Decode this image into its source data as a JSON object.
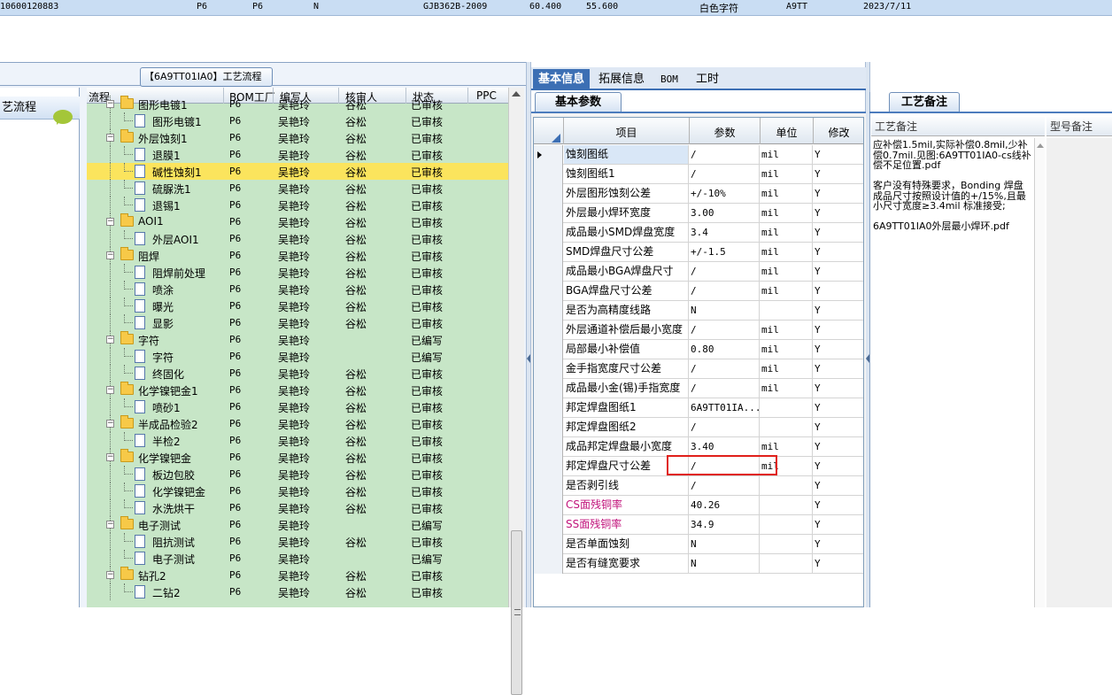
{
  "top_row": {
    "id": "10600120883",
    "c1": "P6",
    "c2": "P6",
    "c3": "N",
    "std": "GJB362B-2009",
    "v1": "60.400",
    "v2": "55.600",
    "char": "白色字符",
    "code": "A9TT",
    "date": "2023/7/11"
  },
  "left": {
    "process_button": "【6A9TT01IA0】工艺流程",
    "side_item": "艺流程",
    "tree_headers": [
      "流程",
      "BOM工厂",
      "编写人",
      "核审人",
      "状态",
      "PPC"
    ],
    "rows": [
      {
        "name": "图形电镀1",
        "type": "folder",
        "level": 1,
        "bom": "P6",
        "writer": "吴艳玲",
        "reviewer": "谷松",
        "status": "已审核"
      },
      {
        "name": "图形电镀1",
        "type": "doc",
        "level": 2,
        "bom": "P6",
        "writer": "吴艳玲",
        "reviewer": "谷松",
        "status": "已审核"
      },
      {
        "name": "外层蚀刻1",
        "type": "folder",
        "level": 1,
        "bom": "P6",
        "writer": "吴艳玲",
        "reviewer": "谷松",
        "status": "已审核"
      },
      {
        "name": "退膜1",
        "type": "doc",
        "level": 2,
        "bom": "P6",
        "writer": "吴艳玲",
        "reviewer": "谷松",
        "status": "已审核"
      },
      {
        "name": "碱性蚀刻1",
        "type": "doc",
        "level": 2,
        "bom": "P6",
        "writer": "吴艳玲",
        "reviewer": "谷松",
        "status": "已审核",
        "selected": true
      },
      {
        "name": "硫脲洗1",
        "type": "doc",
        "level": 2,
        "bom": "P6",
        "writer": "吴艳玲",
        "reviewer": "谷松",
        "status": "已审核"
      },
      {
        "name": "退锡1",
        "type": "doc",
        "level": 2,
        "bom": "P6",
        "writer": "吴艳玲",
        "reviewer": "谷松",
        "status": "已审核"
      },
      {
        "name": "AOI1",
        "type": "folder",
        "level": 1,
        "bom": "P6",
        "writer": "吴艳玲",
        "reviewer": "谷松",
        "status": "已审核"
      },
      {
        "name": "外层AOI1",
        "type": "doc",
        "level": 2,
        "bom": "P6",
        "writer": "吴艳玲",
        "reviewer": "谷松",
        "status": "已审核"
      },
      {
        "name": "阻焊",
        "type": "folder",
        "level": 1,
        "bom": "P6",
        "writer": "吴艳玲",
        "reviewer": "谷松",
        "status": "已审核"
      },
      {
        "name": "阻焊前处理",
        "type": "doc",
        "level": 2,
        "bom": "P6",
        "writer": "吴艳玲",
        "reviewer": "谷松",
        "status": "已审核"
      },
      {
        "name": "喷涂",
        "type": "doc",
        "level": 2,
        "bom": "P6",
        "writer": "吴艳玲",
        "reviewer": "谷松",
        "status": "已审核"
      },
      {
        "name": "曝光",
        "type": "doc",
        "level": 2,
        "bom": "P6",
        "writer": "吴艳玲",
        "reviewer": "谷松",
        "status": "已审核"
      },
      {
        "name": "显影",
        "type": "doc",
        "level": 2,
        "bom": "P6",
        "writer": "吴艳玲",
        "reviewer": "谷松",
        "status": "已审核"
      },
      {
        "name": "字符",
        "type": "folder",
        "level": 1,
        "bom": "P6",
        "writer": "吴艳玲",
        "reviewer": "",
        "status": "已编写"
      },
      {
        "name": "字符",
        "type": "doc",
        "level": 2,
        "bom": "P6",
        "writer": "吴艳玲",
        "reviewer": "",
        "status": "已编写"
      },
      {
        "name": "终固化",
        "type": "doc",
        "level": 2,
        "bom": "P6",
        "writer": "吴艳玲",
        "reviewer": "谷松",
        "status": "已审核"
      },
      {
        "name": "化学镍钯金1",
        "type": "folder",
        "level": 1,
        "bom": "P6",
        "writer": "吴艳玲",
        "reviewer": "谷松",
        "status": "已审核"
      },
      {
        "name": "喷砂1",
        "type": "doc",
        "level": 2,
        "bom": "P6",
        "writer": "吴艳玲",
        "reviewer": "谷松",
        "status": "已审核"
      },
      {
        "name": "半成品检验2",
        "type": "folder",
        "level": 1,
        "bom": "P6",
        "writer": "吴艳玲",
        "reviewer": "谷松",
        "status": "已审核"
      },
      {
        "name": "半检2",
        "type": "doc",
        "level": 2,
        "bom": "P6",
        "writer": "吴艳玲",
        "reviewer": "谷松",
        "status": "已审核"
      },
      {
        "name": "化学镍钯金",
        "type": "folder",
        "level": 1,
        "bom": "P6",
        "writer": "吴艳玲",
        "reviewer": "谷松",
        "status": "已审核"
      },
      {
        "name": "板边包胶",
        "type": "doc",
        "level": 2,
        "bom": "P6",
        "writer": "吴艳玲",
        "reviewer": "谷松",
        "status": "已审核"
      },
      {
        "name": "化学镍钯金",
        "type": "doc",
        "level": 2,
        "bom": "P6",
        "writer": "吴艳玲",
        "reviewer": "谷松",
        "status": "已审核"
      },
      {
        "name": "水洗烘干",
        "type": "doc",
        "level": 2,
        "bom": "P6",
        "writer": "吴艳玲",
        "reviewer": "谷松",
        "status": "已审核"
      },
      {
        "name": "电子测试",
        "type": "folder",
        "level": 1,
        "bom": "P6",
        "writer": "吴艳玲",
        "reviewer": "",
        "status": "已编写"
      },
      {
        "name": "阻抗测试",
        "type": "doc",
        "level": 2,
        "bom": "P6",
        "writer": "吴艳玲",
        "reviewer": "谷松",
        "status": "已审核"
      },
      {
        "name": "电子测试",
        "type": "doc",
        "level": 2,
        "bom": "P6",
        "writer": "吴艳玲",
        "reviewer": "",
        "status": "已编写"
      },
      {
        "name": "钻孔2",
        "type": "folder",
        "level": 1,
        "bom": "P6",
        "writer": "吴艳玲",
        "reviewer": "谷松",
        "status": "已审核"
      },
      {
        "name": "二钻2",
        "type": "doc",
        "level": 2,
        "bom": "P6",
        "writer": "吴艳玲",
        "reviewer": "谷松",
        "status": "已审核"
      }
    ]
  },
  "middle": {
    "tabs": [
      "基本信息",
      "拓展信息",
      "BOM",
      "工时"
    ],
    "subtab": "基本参数",
    "headers": [
      "项目",
      "参数",
      "单位",
      "修改"
    ],
    "rows": [
      {
        "item": "蚀刻图纸",
        "param": "/",
        "unit": "mil",
        "mod": "Y",
        "current": true
      },
      {
        "item": "蚀刻图纸1",
        "param": "/",
        "unit": "mil",
        "mod": "Y"
      },
      {
        "item": "外层图形蚀刻公差",
        "param": "+/-10%",
        "unit": "mil",
        "mod": "Y"
      },
      {
        "item": "外层最小焊环宽度",
        "param": "3.00",
        "unit": "mil",
        "mod": "Y"
      },
      {
        "item": "成品最小SMD焊盘宽度",
        "param": "3.4",
        "unit": "mil",
        "mod": "Y"
      },
      {
        "item": "SMD焊盘尺寸公差",
        "param": "+/-1.5",
        "unit": "mil",
        "mod": "Y"
      },
      {
        "item": "成品最小BGA焊盘尺寸",
        "param": "/",
        "unit": "mil",
        "mod": "Y"
      },
      {
        "item": "BGA焊盘尺寸公差",
        "param": "/",
        "unit": "mil",
        "mod": "Y"
      },
      {
        "item": "是否为高精度线路",
        "param": "N",
        "unit": "",
        "mod": "Y"
      },
      {
        "item": "外层通道补偿后最小宽度",
        "param": "/",
        "unit": "mil",
        "mod": "Y"
      },
      {
        "item": "局部最小补偿值",
        "param": "0.80",
        "unit": "mil",
        "mod": "Y"
      },
      {
        "item": "金手指宽度尺寸公差",
        "param": "/",
        "unit": "mil",
        "mod": "Y"
      },
      {
        "item": "成品最小金(锡)手指宽度",
        "param": "/",
        "unit": "mil",
        "mod": "Y"
      },
      {
        "item": "邦定焊盘图纸1",
        "param": "6A9TT01IA...",
        "unit": "",
        "mod": "Y"
      },
      {
        "item": "邦定焊盘图纸2",
        "param": "/",
        "unit": "",
        "mod": "Y"
      },
      {
        "item": "成品邦定焊盘最小宽度",
        "param": "3.40",
        "unit": "mil",
        "mod": "Y"
      },
      {
        "item": "邦定焊盘尺寸公差",
        "param": "/",
        "unit": "mil",
        "mod": "Y"
      },
      {
        "item": "是否剥引线",
        "param": "/",
        "unit": "",
        "mod": "Y"
      },
      {
        "item": "CS面残铜率",
        "param": "40.26",
        "unit": "",
        "mod": "Y",
        "pink": true
      },
      {
        "item": "SS面残铜率",
        "param": "34.9",
        "unit": "",
        "mod": "Y",
        "pink": true
      },
      {
        "item": "是否单面蚀刻",
        "param": "N",
        "unit": "",
        "mod": "Y"
      },
      {
        "item": "是否有缝宽要求",
        "param": "N",
        "unit": "",
        "mod": "Y"
      }
    ]
  },
  "right": {
    "tab": "工艺备注",
    "col1": "工艺备注",
    "col2": "型号备注",
    "note": "应补偿1.5mil,实际补偿0.8mil,少补偿0.7mil.见图:6A9TT01IA0-cs线补偿不足位置.pdf\n\n客户没有特殊要求，Bonding 焊盘成品尺寸按照设计值的+/15%,且最小尺寸宽度≥3.4mil 标准接受;\n\n6A9TT01IA0外层最小焊环.pdf"
  },
  "colors": {
    "accent": "#3c6fb4",
    "tree_bg": "#c7e6c7",
    "selected_row": "#fbe45d",
    "highlight_box": "#e0201a",
    "pink_text": "#c1137b"
  }
}
